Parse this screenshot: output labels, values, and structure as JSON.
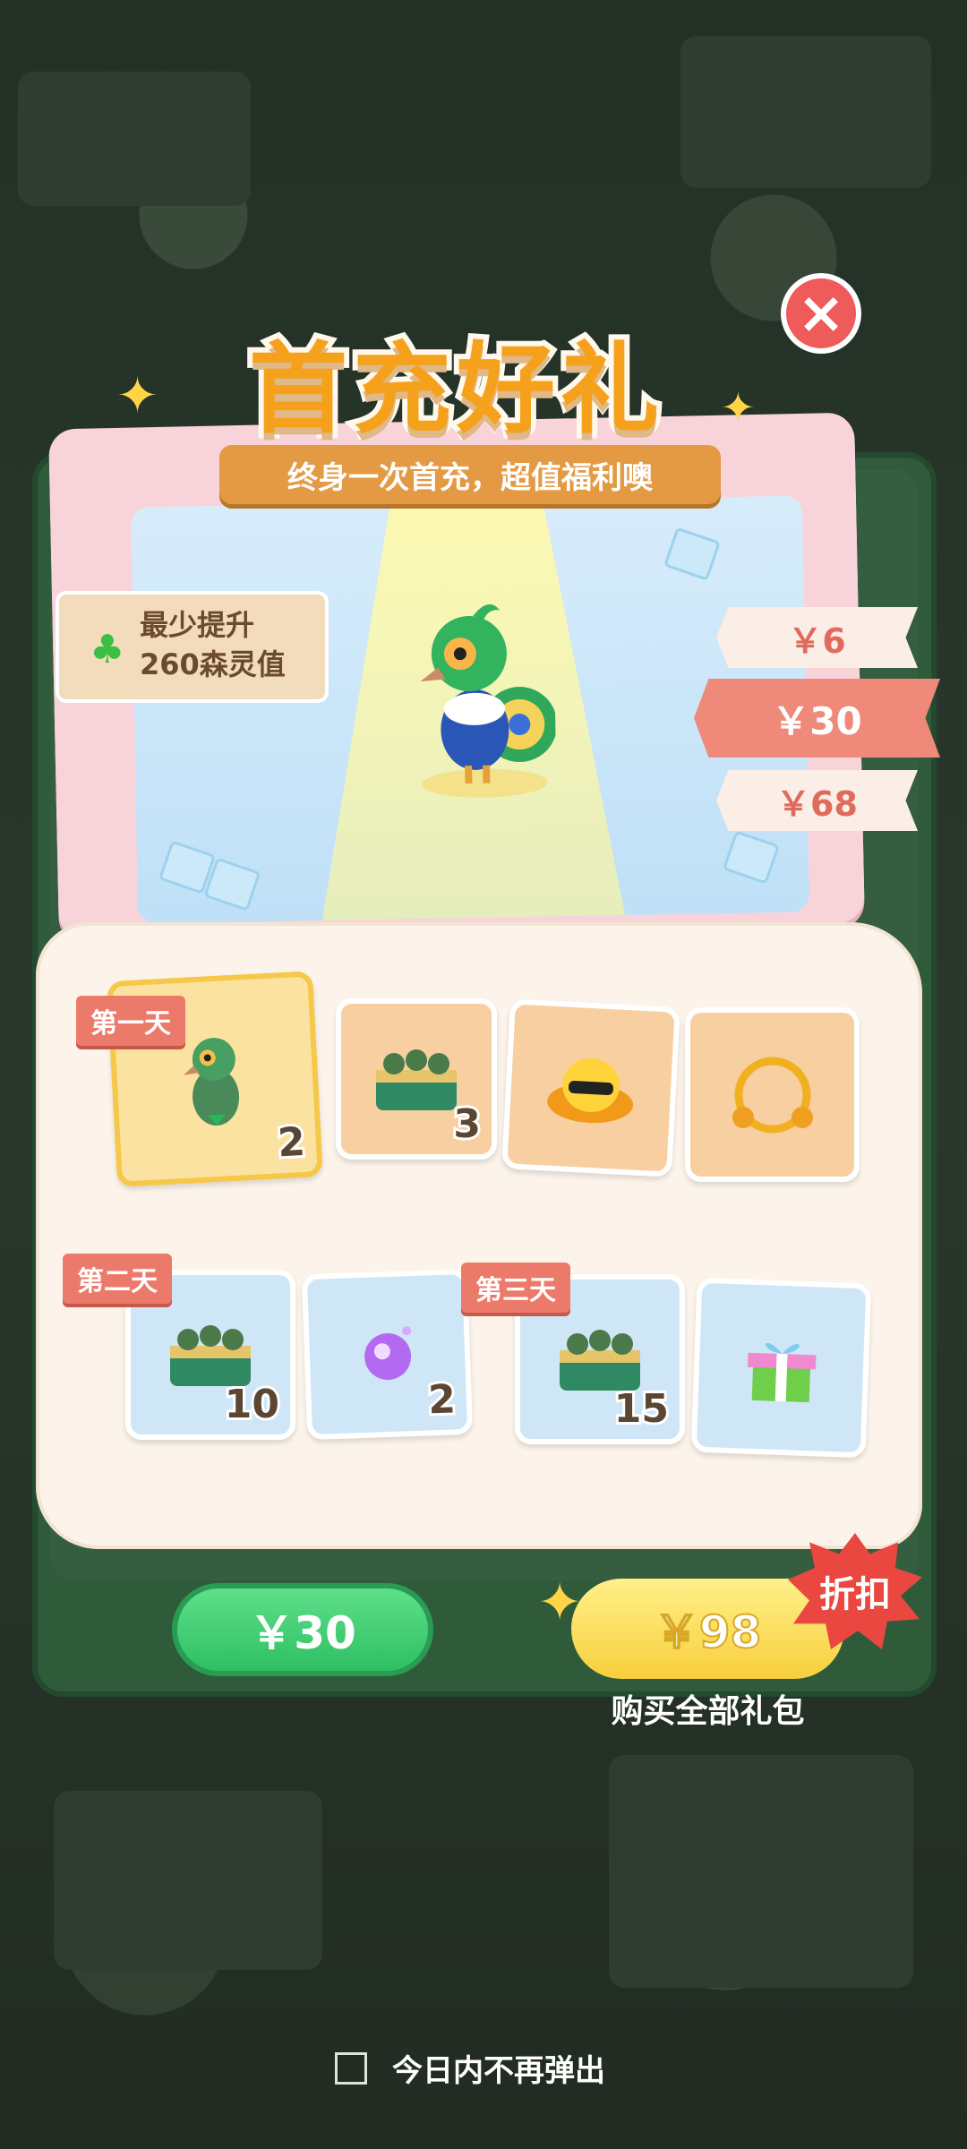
{
  "popup": {
    "title": "首充好礼",
    "subtitle": "终身一次首充，超值福利噢",
    "boost_tag": {
      "line1": "最少提升",
      "line2": "260森灵值",
      "icon": "clover-icon"
    },
    "close_icon": "close-icon"
  },
  "price_tabs": [
    {
      "label": "￥6",
      "selected": false
    },
    {
      "label": "￥30",
      "selected": true
    },
    {
      "label": "￥68",
      "selected": false
    }
  ],
  "days": [
    {
      "label": "第一天",
      "items": [
        {
          "icon": "parrot-icon",
          "count": "2"
        },
        {
          "icon": "crate-icon",
          "count": "3"
        },
        {
          "icon": "duck-hat-icon",
          "count": ""
        },
        {
          "icon": "gold-ring-icon",
          "count": ""
        }
      ]
    },
    {
      "label": "第二天",
      "items": [
        {
          "icon": "crate-icon",
          "count": "10"
        },
        {
          "icon": "magic-orb-icon",
          "count": "2"
        }
      ]
    },
    {
      "label": "第三天",
      "items": [
        {
          "icon": "crate-icon",
          "count": "15"
        },
        {
          "icon": "gift-box-icon",
          "count": ""
        }
      ]
    }
  ],
  "buttons": {
    "buy_selected": "￥30",
    "buy_all_price": "￥98",
    "buy_all_label": "购买全部礼包",
    "discount_badge": "折扣"
  },
  "footer": {
    "checkbox_label": "今日内不再弹出",
    "checked": false
  },
  "colors": {
    "title": "#f5a11c",
    "green_button": "#2fbf63",
    "yellow_button": "#f8cf3c",
    "tag": "#ec7a6a"
  }
}
